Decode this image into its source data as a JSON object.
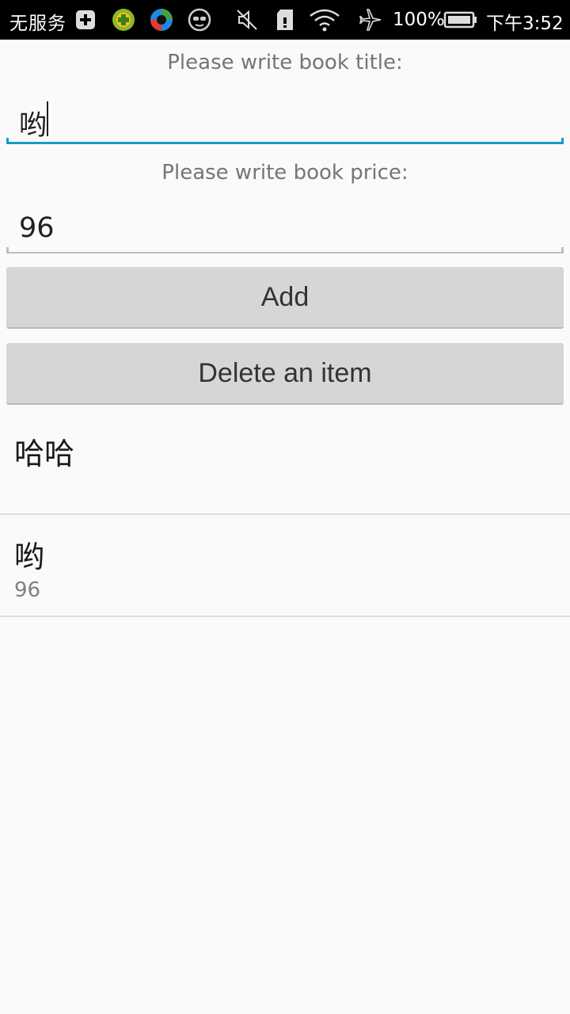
{
  "status_bar": {
    "carrier": "无服务",
    "battery": "100%",
    "time": "下午3:52",
    "icons": [
      "add-box-icon",
      "game-app-icon",
      "browser-app-icon",
      "glasses-icon",
      "mute-icon",
      "sd-card-icon",
      "wifi-icon",
      "airplane-icon",
      "battery-icon"
    ]
  },
  "form": {
    "title_label": "Please write book title:",
    "title_value": "哟",
    "price_label": "Please write book price:",
    "price_value": "96",
    "focused_accent": "#1a9bc7",
    "unfocused_line": "#bdbdbd"
  },
  "buttons": {
    "add": "Add",
    "delete": "Delete an item"
  },
  "books": [
    {
      "title": "哈哈",
      "price": ""
    },
    {
      "title": "哟",
      "price": "96"
    }
  ]
}
